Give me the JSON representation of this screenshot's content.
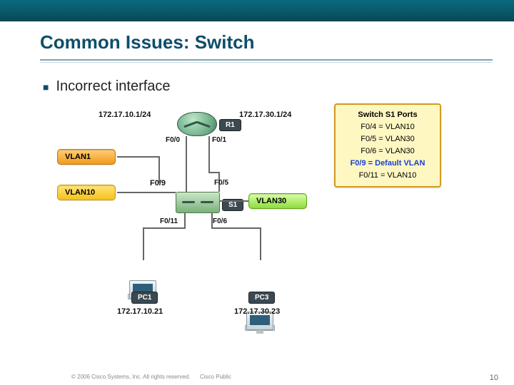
{
  "header": {
    "title": "Common Issues: Switch"
  },
  "bullet": {
    "text": "Incorrect interface"
  },
  "router": {
    "name": "R1",
    "left_ip": "172.17.10.1/24",
    "right_ip": "172.17.30.1/24",
    "port_left": "F0/0",
    "port_right": "F0/1"
  },
  "switch": {
    "name": "S1",
    "port_up_left": "F0/9",
    "port_up_right": "F0/5",
    "port_down_left": "F0/11",
    "port_down_right": "F0/6"
  },
  "vlans": {
    "v1": "VLAN1",
    "v10": "VLAN10",
    "v30": "VLAN30"
  },
  "pcs": [
    {
      "name": "PC1",
      "ip": "172.17.10.21"
    },
    {
      "name": "PC3",
      "ip": "172.17.30.23"
    }
  ],
  "ports_box": {
    "header": "Switch S1 Ports",
    "lines": [
      "F0/4 = VLAN10",
      "F0/5 = VLAN30",
      "F0/6 = VLAN30"
    ],
    "highlight": "F0/9 = Default VLAN",
    "after": "F0/11 = VLAN10"
  },
  "footer": {
    "copyright": "© 2006 Cisco Systems, Inc. All rights reserved.",
    "label": "Cisco Public",
    "page": "10"
  },
  "chart_data": {
    "type": "diagram",
    "nodes": [
      {
        "id": "R1",
        "kind": "router",
        "ips": [
          "172.17.10.1/24",
          "172.17.30.1/24"
        ]
      },
      {
        "id": "S1",
        "kind": "switch"
      },
      {
        "id": "PC1",
        "kind": "pc",
        "ip": "172.17.10.21"
      },
      {
        "id": "PC3",
        "kind": "pc",
        "ip": "172.17.30.23"
      }
    ],
    "vlans": [
      "VLAN1",
      "VLAN10",
      "VLAN30"
    ],
    "edges": [
      {
        "from": "R1",
        "port": "F0/0",
        "to": "S1",
        "to_port": "F0/9"
      },
      {
        "from": "R1",
        "port": "F0/1",
        "to": "S1",
        "to_port": "F0/5"
      },
      {
        "from": "S1",
        "port": "F0/11",
        "to": "PC1"
      },
      {
        "from": "S1",
        "port": "F0/6",
        "to": "PC3"
      }
    ],
    "switch_port_vlan_map": {
      "F0/4": "VLAN10",
      "F0/5": "VLAN30",
      "F0/6": "VLAN30",
      "F0/9": "Default VLAN",
      "F0/11": "VLAN10"
    },
    "title": "Common Issues: Switch — Incorrect interface"
  }
}
